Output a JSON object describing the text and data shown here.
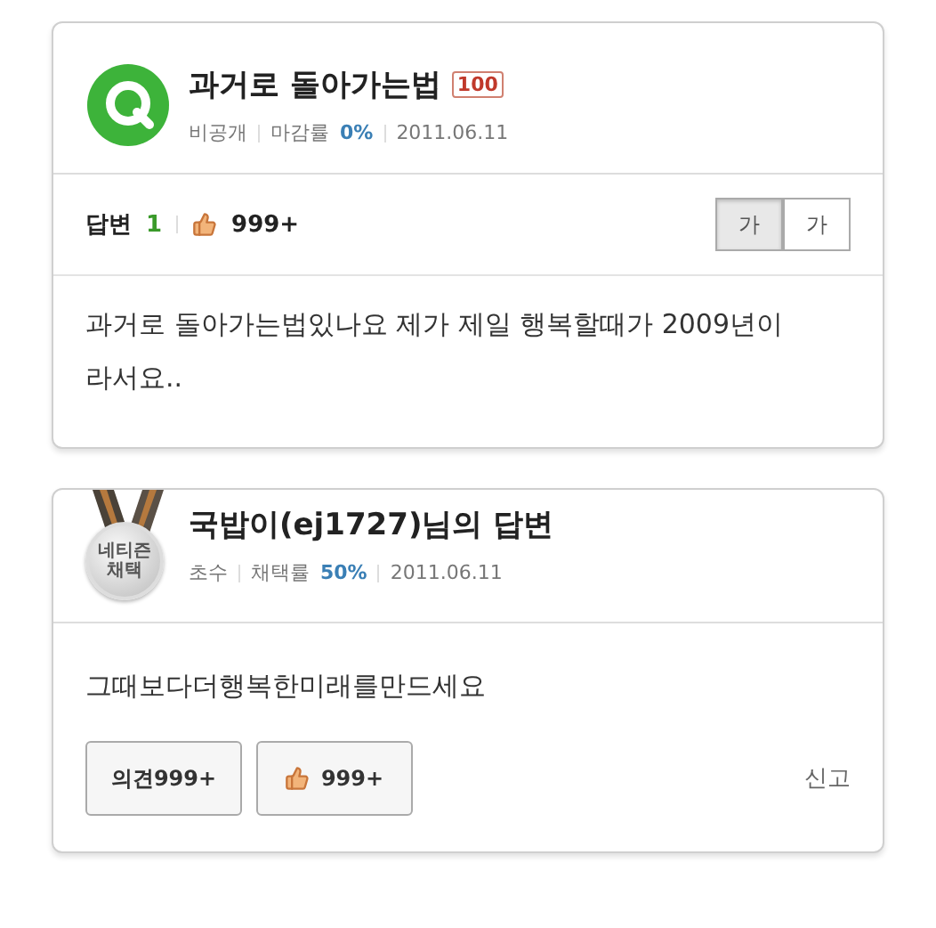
{
  "question": {
    "title": "과거로 돌아가는법",
    "points": "100",
    "privacy": "비공개",
    "rate_label": "마감률",
    "rate": "0%",
    "date": "2011.06.11",
    "answers_label": "답변",
    "answers": "1",
    "likes": "999+",
    "font_buttons": [
      {
        "label": "가",
        "selected": true
      },
      {
        "label": "가",
        "selected": false
      }
    ],
    "body": "과거로 돌아가는법있나요 제가 제일 행복할때가 2009년이라서요.."
  },
  "answer": {
    "badge": "네티즌 채택",
    "title": "국밥이(ej1727)님의 답변",
    "level": "초수",
    "rate_label": "채택률",
    "rate": "50%",
    "date": "2011.06.11",
    "body": "그때보다더행복한미래를만드세요",
    "opinion_button": "의견999+",
    "likes": "999+",
    "report": "신고"
  }
}
